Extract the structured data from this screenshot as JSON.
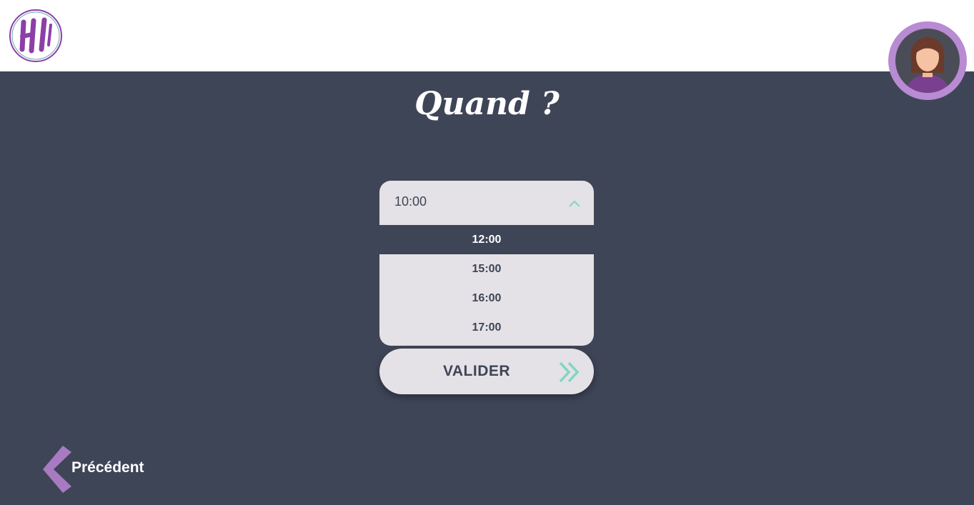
{
  "header": {
    "logo_text": "HI",
    "logo_icon": "hi-logo-icon",
    "avatar_icon": "user-avatar-icon"
  },
  "page": {
    "title": "Quand ?"
  },
  "time_select": {
    "current_value": "10:00",
    "toggle_icon": "chevron-up-icon",
    "options": [
      {
        "label": "12:00",
        "active": true
      },
      {
        "label": "15:00",
        "active": false
      },
      {
        "label": "16:00",
        "active": false
      },
      {
        "label": "17:00",
        "active": false
      }
    ]
  },
  "actions": {
    "validate_label": "VALIDER",
    "validate_icon": "double-chevron-right-icon",
    "previous_label": "Précédent",
    "previous_icon": "chevron-left-icon"
  },
  "colors": {
    "background": "#3e4557",
    "header_bg": "#ffffff",
    "panel": "#e4e2e6",
    "accent_purple": "#b88bd2",
    "logo_purple": "#8c3fa8",
    "accent_teal": "#7fd6c2",
    "text_dark": "#3e4557",
    "text_light": "#ffffff"
  }
}
